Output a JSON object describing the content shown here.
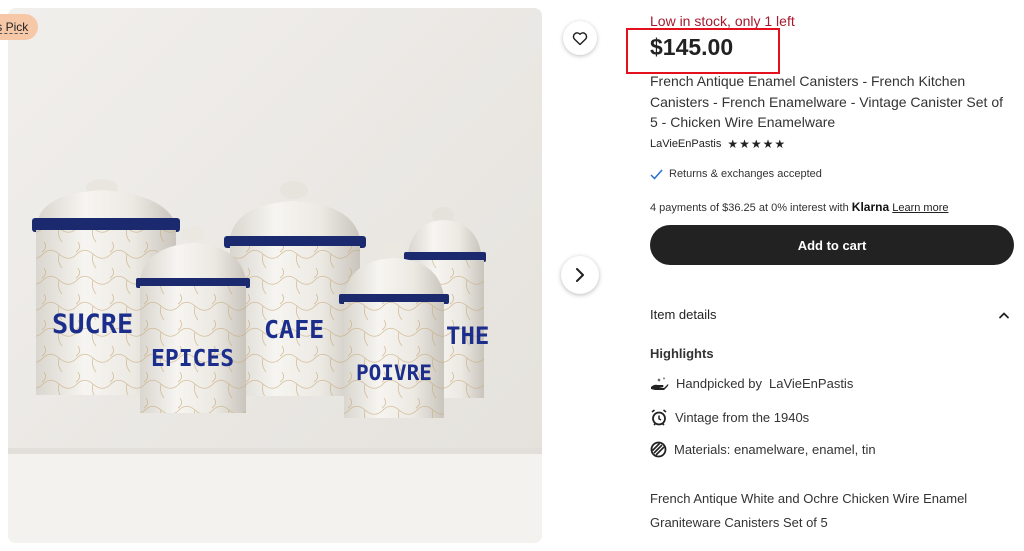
{
  "badge": {
    "label": "'s Pick"
  },
  "gallery": {
    "image_alt": "Five white enamel canisters with blue lettering",
    "canister_labels": [
      "SUCRE",
      "EPICES",
      "CAFE",
      "POIVRE",
      "THE"
    ]
  },
  "product": {
    "stock_notice": "Low in stock, only 1 left",
    "price": "$145.00",
    "title": "French Antique Enamel Canisters - French Kitchen Canisters - French Enamelware - Vintage Canister Set of 5 - Chicken Wire Enamelware",
    "seller": "LaVieEnPastis",
    "rating_stars": "★★★★★",
    "rating": 5,
    "returns": "Returns & exchanges accepted",
    "payments_text": "4 payments of $36.25 at 0% interest with",
    "payments_brand": "Klarna",
    "payments_link": "Learn more",
    "add_to_cart": "Add to cart"
  },
  "details": {
    "header": "Item details",
    "highlights_title": "Highlights",
    "handpicked_prefix": "Handpicked by",
    "handpicked_by": "LaVieEnPastis",
    "vintage": "Vintage from the 1940s",
    "materials": "Materials: enamelware, enamel, tin",
    "description": "French Antique White and Ochre Chicken Wire Enamel Graniteware Canisters Set of 5"
  },
  "colors": {
    "stock_red": "#a61a2e",
    "highlight_box": "#e5101d",
    "button_dark": "#222222",
    "badge_peach": "#f7c8a8",
    "lettering_blue": "#1c2e8c"
  },
  "icons": [
    "heart-icon",
    "chevron-right-icon",
    "checkmark-icon",
    "chevron-up-icon",
    "hand-icon",
    "alarm-clock-icon",
    "material-icon"
  ]
}
